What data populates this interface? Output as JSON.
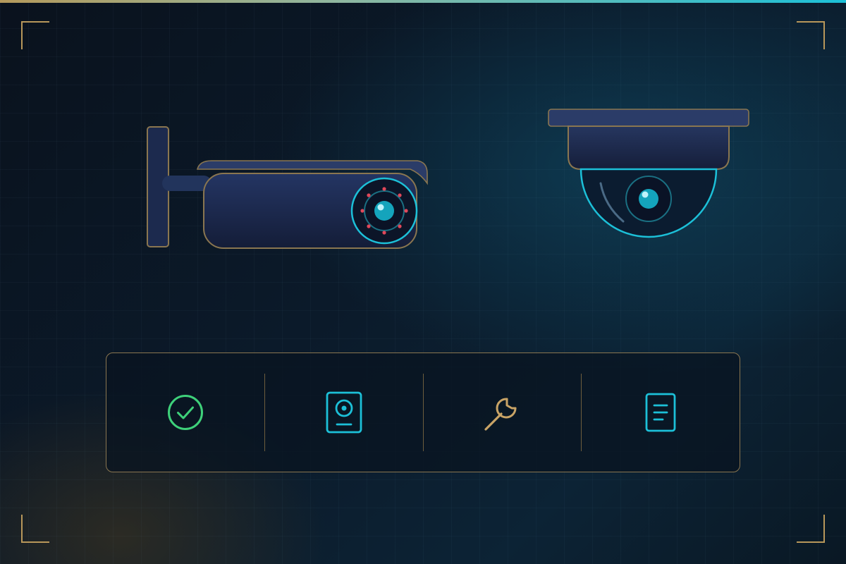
{
  "colors": {
    "background": "#0b1a2a",
    "accent_gold": "#b8975a",
    "accent_cyan": "#1cc0d8",
    "success_green": "#3ed17a",
    "camera_body": "#1a2748",
    "alert_red": "#e0485a"
  },
  "illustrations": [
    {
      "name": "bullet-camera",
      "icon": "bullet-security-camera"
    },
    {
      "name": "dome-camera",
      "icon": "dome-security-camera"
    }
  ],
  "toolbar": {
    "items": [
      {
        "icon": "check-circle-icon",
        "color": "#3ed17a"
      },
      {
        "icon": "storage-drive-icon",
        "color": "#1cc0d8"
      },
      {
        "icon": "wrench-icon",
        "color": "#c9a466"
      },
      {
        "icon": "document-icon",
        "color": "#1cc0d8"
      }
    ]
  }
}
